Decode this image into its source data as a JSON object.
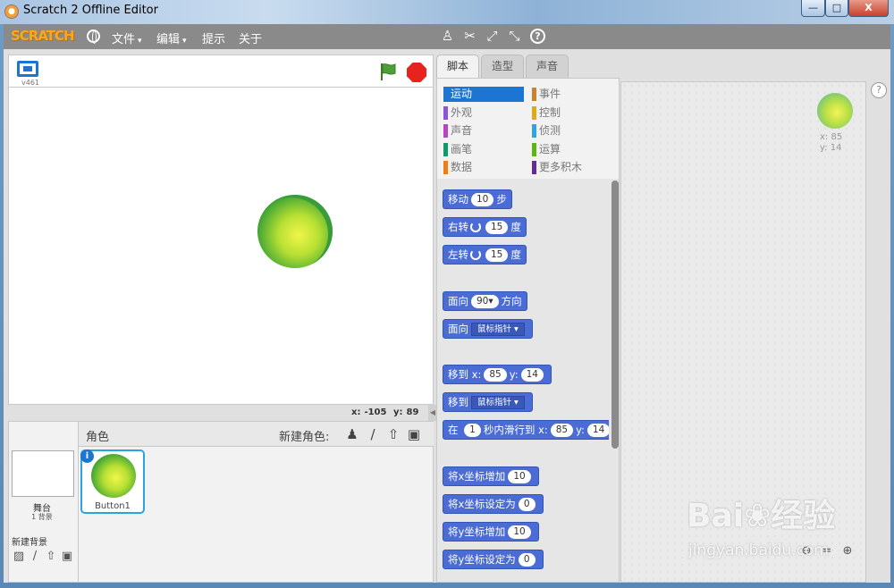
{
  "window": {
    "title": "Scratch 2 Offline Editor",
    "minimize": "—",
    "maximize": "□",
    "close": "X"
  },
  "menubar": {
    "logo": "SCRATCH",
    "items": [
      {
        "label": "文件",
        "has_caret": true
      },
      {
        "label": "编辑",
        "has_caret": true
      },
      {
        "label": "提示",
        "has_caret": false
      },
      {
        "label": "关于",
        "has_caret": false
      }
    ],
    "caret": "▾",
    "tools": [
      {
        "icon": "duplicate-stamp-icon",
        "glyph": "♙"
      },
      {
        "icon": "delete-scissors-icon",
        "glyph": "✂"
      },
      {
        "icon": "grow-icon",
        "glyph": "⤢"
      },
      {
        "icon": "shrink-icon",
        "glyph": "⤡"
      },
      {
        "icon": "help-question-icon",
        "glyph": "?"
      }
    ]
  },
  "stage": {
    "version": "v461",
    "mouse_x_label": "x:",
    "mouse_x": "-105",
    "mouse_y_label": "y:",
    "mouse_y": "89",
    "collapse_glyph": "◀"
  },
  "sprites_pane": {
    "title": "角色",
    "new_sprite_label": "新建角色:",
    "new_sprite_icons": [
      {
        "icon": "choose-from-library-icon",
        "glyph": "♟"
      },
      {
        "icon": "paint-brush-icon",
        "glyph": "/"
      },
      {
        "icon": "upload-icon",
        "glyph": "⇧"
      },
      {
        "icon": "camera-icon",
        "glyph": "▣"
      }
    ],
    "stage_label": "舞台",
    "stage_bg_count": "1 背景",
    "new_backdrop_label": "新建背景",
    "backdrop_icons": [
      {
        "icon": "backdrop-library-icon",
        "glyph": "▨"
      },
      {
        "icon": "backdrop-paint-icon",
        "glyph": "/"
      },
      {
        "icon": "backdrop-upload-icon",
        "glyph": "⇧"
      },
      {
        "icon": "backdrop-camera-icon",
        "glyph": "▣"
      }
    ],
    "sprite": {
      "name": "Button1",
      "info": "i"
    }
  },
  "tabs": [
    {
      "label": "脚本",
      "active": true
    },
    {
      "label": "造型",
      "active": false
    },
    {
      "label": "声音",
      "active": false
    }
  ],
  "categories": [
    {
      "label": "运动",
      "color": "#4a6cd4",
      "active": true
    },
    {
      "label": "事件",
      "color": "#c88330"
    },
    {
      "label": "外观",
      "color": "#8a55d7"
    },
    {
      "label": "控制",
      "color": "#e1a91a"
    },
    {
      "label": "声音",
      "color": "#bb42c3"
    },
    {
      "label": "侦测",
      "color": "#2ca5e2"
    },
    {
      "label": "画笔",
      "color": "#0e9a6c"
    },
    {
      "label": "运算",
      "color": "#5cb712"
    },
    {
      "label": "数据",
      "color": "#ee7d16"
    },
    {
      "label": "更多积木",
      "color": "#632d99"
    }
  ],
  "blocks": {
    "move": {
      "pre": "移动",
      "val": "10",
      "post": "步"
    },
    "turn_right": {
      "pre": "右转",
      "val": "15",
      "post": "度"
    },
    "turn_left": {
      "pre": "左转",
      "val": "15",
      "post": "度"
    },
    "point_dir": {
      "pre": "面向",
      "val": "90▾",
      "post": "方向"
    },
    "point_towards": {
      "pre": "面向",
      "dd": "鼠标指针 ▾"
    },
    "goto_xy": {
      "pre": "移到",
      "xl": "x:",
      "x": "85",
      "yl": "y:",
      "y": "14"
    },
    "goto": {
      "pre": "移到",
      "dd": "鼠标指针 ▾"
    },
    "glide": {
      "pre": "在",
      "secs": "1",
      "mid": "秒内滑行到",
      "xl": "x:",
      "x": "85",
      "yl": "y:",
      "y": "14"
    },
    "change_x": {
      "pre": "将x坐标增加",
      "val": "10"
    },
    "set_x": {
      "pre": "将x坐标设定为",
      "val": "0"
    },
    "change_y": {
      "pre": "将y坐标增加",
      "val": "10"
    },
    "set_y": {
      "pre": "将y坐标设定为",
      "val": "0"
    }
  },
  "scripts_area": {
    "sprite_x_label": "x:",
    "sprite_x": "85",
    "sprite_y_label": "y:",
    "sprite_y": "14",
    "zoom_icons": [
      {
        "icon": "zoom-out-icon",
        "glyph": "⊖"
      },
      {
        "icon": "zoom-reset-icon",
        "glyph": "="
      },
      {
        "icon": "zoom-in-icon",
        "glyph": "⊕"
      }
    ],
    "help": "?"
  },
  "watermark": {
    "logo": "Bai❀经验",
    "url": "jingyan.baidu.com"
  }
}
